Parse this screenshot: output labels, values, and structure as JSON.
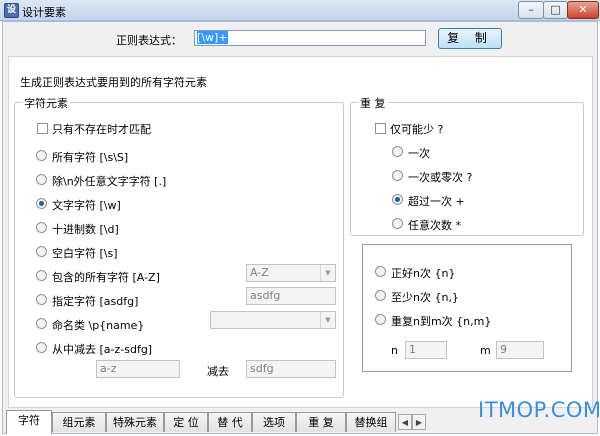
{
  "window": {
    "title": "设计要素",
    "minimize": "–",
    "maximize": "□",
    "close": "✕"
  },
  "header": {
    "regex_label": "正则表达式：",
    "regex_value": "[\\w]+",
    "copy_button": "复 制"
  },
  "section_title": "生成正则表达式要用到的所有字符元素",
  "char_elements": {
    "group_title": "字符元素",
    "not_exist_checkbox": "只有不存在时才匹配",
    "options": [
      {
        "label": "所有字符  [\\s\\S]",
        "selected": false
      },
      {
        "label": "除\\n外任意文字字符  [.]",
        "selected": false
      },
      {
        "label": "文字字符  [\\w]",
        "selected": true
      },
      {
        "label": "十进制数  [\\d]",
        "selected": false
      },
      {
        "label": "空白字符  [\\s]",
        "selected": false
      },
      {
        "label": "包含的所有字符 [A-Z]",
        "selected": false
      },
      {
        "label": "指定字符  [asdfg]",
        "selected": false
      },
      {
        "label": "命名类 \\p{name}",
        "selected": false
      },
      {
        "label": "从中减去  [a-z-sdfg]",
        "selected": false
      }
    ],
    "range_combo_value": "A-Z",
    "specified_field_value": "asdfg",
    "named_class_combo_value": "",
    "subtract_from_value": "a-z",
    "subtract_label": "减去",
    "subtract_value": "sdfg"
  },
  "repeat": {
    "group_title": "重  复",
    "lazy_checkbox": "仅可能少  ?",
    "options": [
      {
        "label": "一次",
        "selected": false
      },
      {
        "label": "一次或零次  ?",
        "selected": false
      },
      {
        "label": "超过一次  +",
        "selected": true
      },
      {
        "label": "任意次数  *",
        "selected": false
      }
    ],
    "count_options": [
      {
        "label": "正好n次  {n}",
        "selected": false
      },
      {
        "label": "至少n次  {n,}",
        "selected": false
      },
      {
        "label": "重复n到m次  {n,m}",
        "selected": false
      }
    ],
    "n_label": "n",
    "n_value": "1",
    "m_label": "m",
    "m_value": "9"
  },
  "tabs": [
    {
      "label": "字符",
      "active": true
    },
    {
      "label": "组元素",
      "active": false
    },
    {
      "label": "特殊元素",
      "active": false
    },
    {
      "label": "定 位",
      "active": false
    },
    {
      "label": "替 代",
      "active": false
    },
    {
      "label": "选项",
      "active": false
    },
    {
      "label": "重 复",
      "active": false
    },
    {
      "label": "替换组",
      "active": false
    }
  ],
  "tab_scroll": {
    "left": "◀",
    "right": "▶"
  },
  "watermark": "ITMOP.COM",
  "colors": {
    "titlebar": "#c3d5ec",
    "selected_radio": "#1f5ca8",
    "copy_button": "#bde0f7",
    "watermark": "#3d8fd7"
  }
}
